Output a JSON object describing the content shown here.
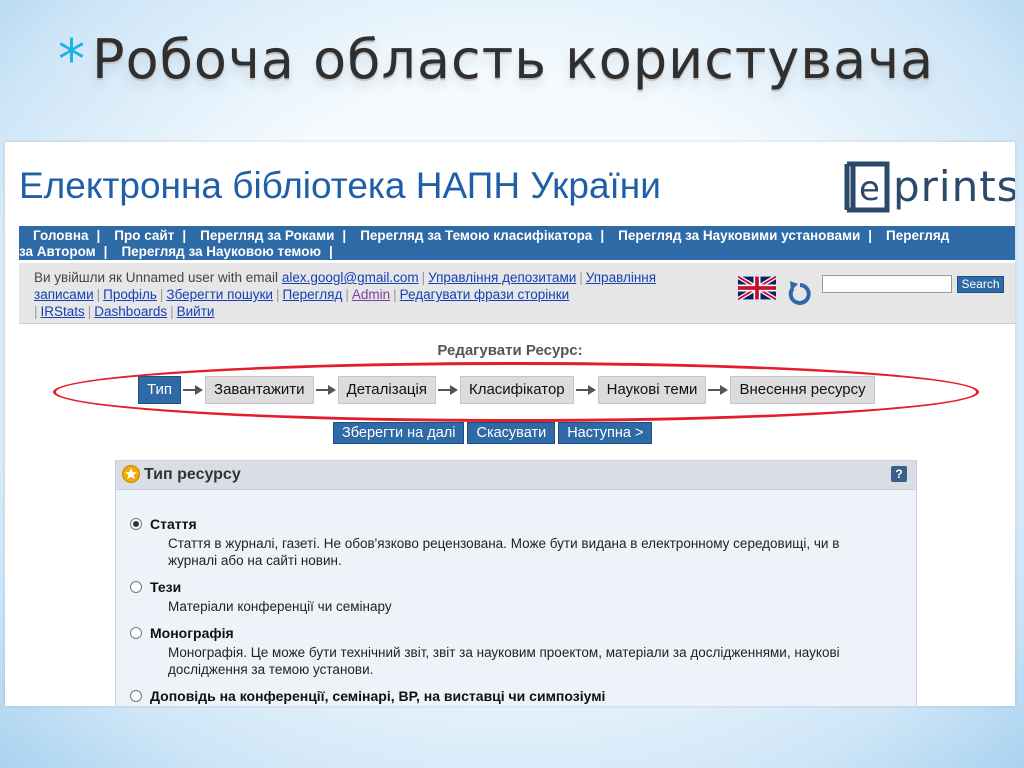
{
  "slide": {
    "star": "*",
    "title": "Робоча область користувача"
  },
  "site": {
    "title": "Електронна бібліотека НАПН України",
    "logo_text": "prints",
    "logo_letter": "e"
  },
  "nav": {
    "row1": [
      "Головна",
      "Про сайт",
      "Перегляд за Роками",
      "Перегляд за Темою класифікатора",
      "Перегляд за Науковими установами",
      "Перегляд"
    ],
    "row2": [
      "за Автором",
      "Перегляд за Науковою темою"
    ]
  },
  "userbar": {
    "logged_in_prefix": "Ви увійшли як Unnamed user with email",
    "email": "alex.googl@gmail.com",
    "links_line1": [
      "Управління депозитами",
      "Управління"
    ],
    "links_line2": [
      "записами",
      "Профіль",
      "Зберегти пошуки",
      "Перегляд",
      "Admin",
      "Редагувати фрази сторінки"
    ],
    "links_line3": [
      "IRStats",
      "Dashboards",
      "Вийти"
    ],
    "search_value": "",
    "search_button": "Search"
  },
  "editor": {
    "title": "Редагувати Ресурс:",
    "steps": [
      "Тип",
      "Завантажити",
      "Деталізація",
      "Класифікатор",
      "Наукові теми",
      "Внесення ресурсу"
    ],
    "active_step": 0,
    "actions": [
      "Зберегти на далі",
      "Скасувати",
      "Наступна >"
    ]
  },
  "resource_type": {
    "title": "Тип ресурсу",
    "help": "?",
    "options": [
      {
        "name": "Стаття",
        "desc": "Стаття в журналі, газеті. Не обов'язково рецензована. Може бути видана в електронному середовищі, чи в журналі або на сайті новин.",
        "checked": true
      },
      {
        "name": "Тези",
        "desc": "Матеріали конференції чи семінару",
        "checked": false
      },
      {
        "name": "Монографія",
        "desc": "Монографія. Це може бути технічний звіт, звіт за науковим проектом, матеріали за дослідженнями, наукові дослідження за темою установи.",
        "checked": false
      },
      {
        "name": "Доповідь на конференції, семінарі, ВР, на виставці чи симпозіумі",
        "desc": "",
        "checked": false
      }
    ]
  },
  "colors": {
    "nav_bg": "#2e6aa6",
    "site_title": "#1f5fa8",
    "annotation": "#e31d2b",
    "slide_star": "#1ab3e6"
  }
}
